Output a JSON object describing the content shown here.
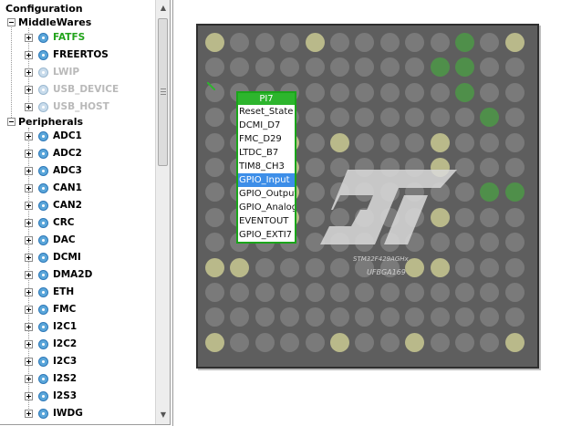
{
  "tree": {
    "title": "Configuration",
    "categories": [
      {
        "label": "MiddleWares",
        "items": [
          {
            "label": "FATFS",
            "status": "ok"
          },
          {
            "label": "FREERTOS",
            "status": "normal"
          },
          {
            "label": "LWIP",
            "status": "disabled"
          },
          {
            "label": "USB_DEVICE",
            "status": "disabled"
          },
          {
            "label": "USB_HOST",
            "status": "disabled"
          }
        ]
      },
      {
        "label": "Peripherals",
        "items": [
          {
            "label": "ADC1"
          },
          {
            "label": "ADC2"
          },
          {
            "label": "ADC3"
          },
          {
            "label": "CAN1"
          },
          {
            "label": "CAN2"
          },
          {
            "label": "CRC"
          },
          {
            "label": "DAC"
          },
          {
            "label": "DCMI"
          },
          {
            "label": "DMA2D"
          },
          {
            "label": "ETH"
          },
          {
            "label": "FMC"
          },
          {
            "label": "I2C1"
          },
          {
            "label": "I2C2"
          },
          {
            "label": "I2C3"
          },
          {
            "label": "I2S2"
          },
          {
            "label": "I2S3"
          },
          {
            "label": "IWDG"
          }
        ]
      }
    ]
  },
  "chip": {
    "name": "STM32F429AGHx",
    "package": "UFBGA169"
  },
  "pin_menu": {
    "title": "PI7",
    "items": [
      "Reset_State",
      "DCMI_D7",
      "FMC_D29",
      "LTDC_B7",
      "TIM8_CH3",
      "GPIO_Input",
      "GPIO_Output",
      "GPIO_Analog",
      "EVENTOUT",
      "GPIO_EXTI7"
    ],
    "selected_index": 5
  },
  "colors": {
    "ok": "#22a31b",
    "disabled": "#b9b9b9",
    "menu_border": "#1aa51a",
    "selection": "#3d8ee8"
  }
}
